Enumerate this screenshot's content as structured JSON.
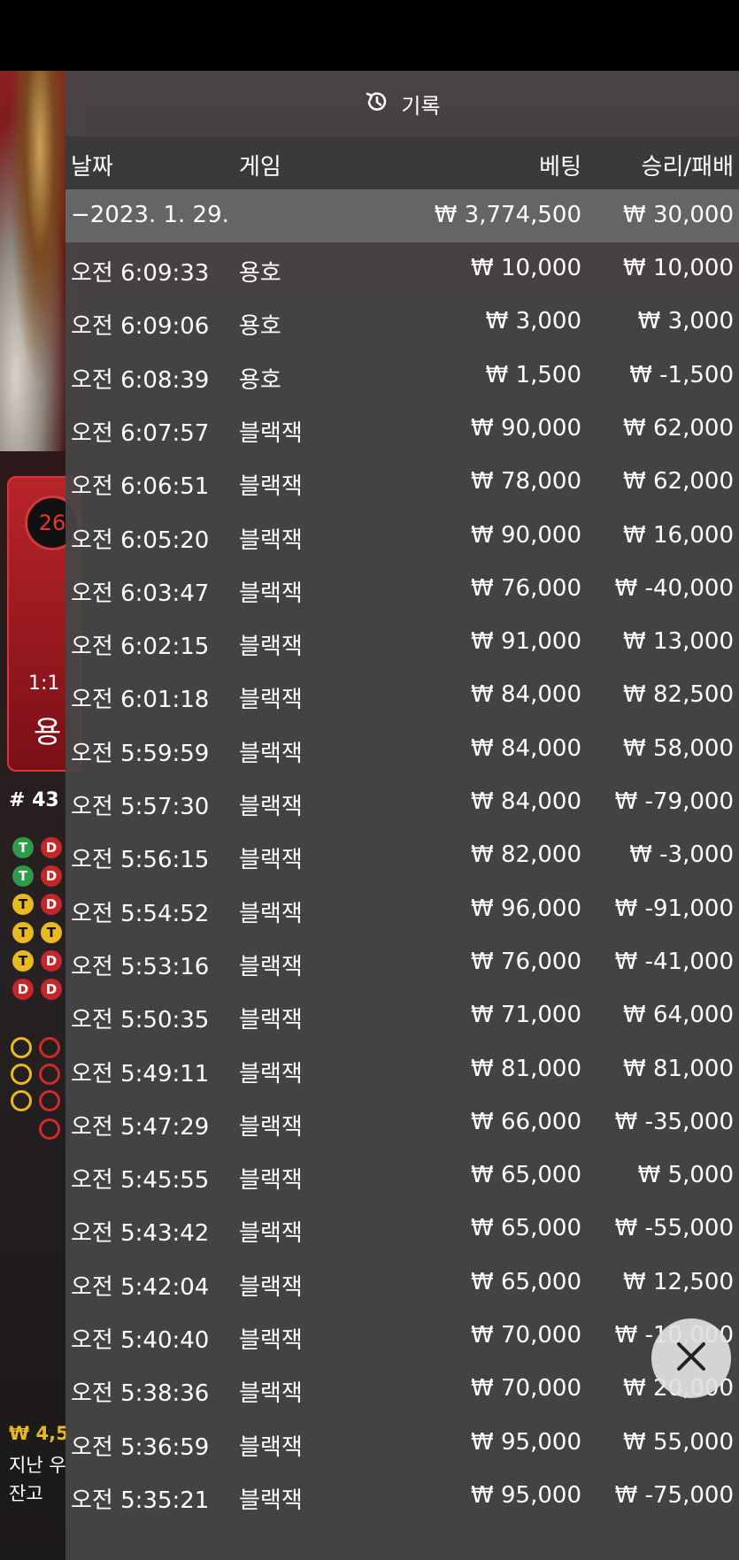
{
  "panel": {
    "title": "기록",
    "columns": {
      "time": "날짜",
      "game": "게임",
      "bet": "베팅",
      "result": "승리/패배"
    },
    "date_group": {
      "date": "−2023. 1. 29.",
      "total_bet": "₩ 3,774,500",
      "total_result": "₩ 30,000"
    },
    "rows": [
      {
        "time": "오전 6:09:33",
        "game": "용호",
        "bet": "₩ 10,000",
        "result": "₩ 10,000"
      },
      {
        "time": "오전 6:09:06",
        "game": "용호",
        "bet": "₩ 3,000",
        "result": "₩ 3,000"
      },
      {
        "time": "오전 6:08:39",
        "game": "용호",
        "bet": "₩ 1,500",
        "result": "₩ -1,500"
      },
      {
        "time": "오전 6:07:57",
        "game": "블랙잭",
        "bet": "₩ 90,000",
        "result": "₩ 62,000"
      },
      {
        "time": "오전 6:06:51",
        "game": "블랙잭",
        "bet": "₩ 78,000",
        "result": "₩ 62,000"
      },
      {
        "time": "오전 6:05:20",
        "game": "블랙잭",
        "bet": "₩ 90,000",
        "result": "₩ 16,000"
      },
      {
        "time": "오전 6:03:47",
        "game": "블랙잭",
        "bet": "₩ 76,000",
        "result": "₩ -40,000"
      },
      {
        "time": "오전 6:02:15",
        "game": "블랙잭",
        "bet": "₩ 91,000",
        "result": "₩ 13,000"
      },
      {
        "time": "오전 6:01:18",
        "game": "블랙잭",
        "bet": "₩ 84,000",
        "result": "₩ 82,500"
      },
      {
        "time": "오전 5:59:59",
        "game": "블랙잭",
        "bet": "₩ 84,000",
        "result": "₩ 58,000"
      },
      {
        "time": "오전 5:57:30",
        "game": "블랙잭",
        "bet": "₩ 84,000",
        "result": "₩ -79,000"
      },
      {
        "time": "오전 5:56:15",
        "game": "블랙잭",
        "bet": "₩ 82,000",
        "result": "₩ -3,000"
      },
      {
        "time": "오전 5:54:52",
        "game": "블랙잭",
        "bet": "₩ 96,000",
        "result": "₩ -91,000"
      },
      {
        "time": "오전 5:53:16",
        "game": "블랙잭",
        "bet": "₩ 76,000",
        "result": "₩ -41,000"
      },
      {
        "time": "오전 5:50:35",
        "game": "블랙잭",
        "bet": "₩ 71,000",
        "result": "₩ 64,000"
      },
      {
        "time": "오전 5:49:11",
        "game": "블랙잭",
        "bet": "₩ 81,000",
        "result": "₩ 81,000"
      },
      {
        "time": "오전 5:47:29",
        "game": "블랙잭",
        "bet": "₩ 66,000",
        "result": "₩ -35,000"
      },
      {
        "time": "오전 5:45:55",
        "game": "블랙잭",
        "bet": "₩ 65,000",
        "result": "₩ 5,000"
      },
      {
        "time": "오전 5:43:42",
        "game": "블랙잭",
        "bet": "₩ 65,000",
        "result": "₩ -55,000"
      },
      {
        "time": "오전 5:42:04",
        "game": "블랙잭",
        "bet": "₩ 65,000",
        "result": "₩ 12,500"
      },
      {
        "time": "오전 5:40:40",
        "game": "블랙잭",
        "bet": "₩ 70,000",
        "result": "₩ -10,000"
      },
      {
        "time": "오전 5:38:36",
        "game": "블랙잭",
        "bet": "₩ 70,000",
        "result": "₩ 20,000"
      },
      {
        "time": "오전 5:36:59",
        "game": "블랙잭",
        "bet": "₩ 95,000",
        "result": "₩ 55,000"
      },
      {
        "time": "오전 5:35:21",
        "game": "블랙잭",
        "bet": "₩ 95,000",
        "result": "₩ -75,000"
      }
    ]
  },
  "background": {
    "circle_number": "26",
    "payout_ratio": "1:1",
    "dragon_char": "용",
    "round_number": "# 43",
    "bead_labels": {
      "tie": "T",
      "dragon": "D"
    },
    "balance_line": "₩ 4,5",
    "last_win_label": "지난 우",
    "balance_label": "잔고"
  },
  "icons": {
    "history": "history-icon",
    "close": "close-icon"
  },
  "colors": {
    "tie": "#e8b923",
    "dragon": "#c8242a",
    "tie_alt": "#2e9b4a"
  }
}
